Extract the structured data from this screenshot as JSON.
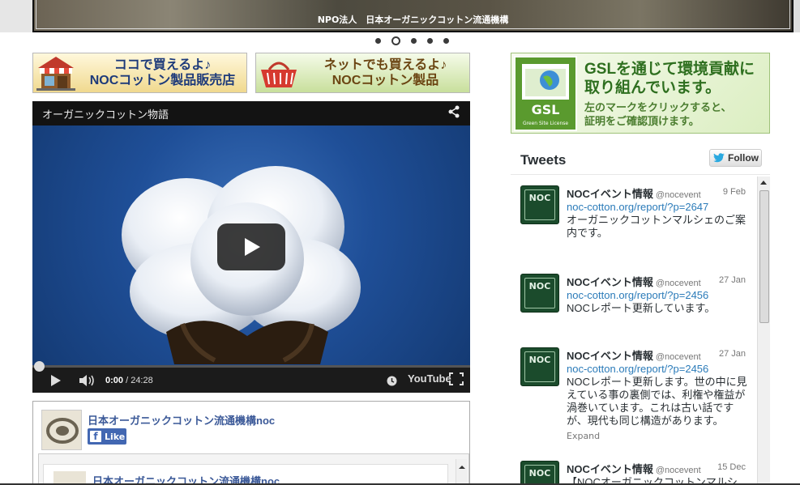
{
  "hero": {
    "caption": "NPO法人　日本オーガニックコットン流通機構",
    "dots": [
      false,
      true,
      false,
      false,
      false
    ]
  },
  "banners": {
    "shop": {
      "line1": "ココで買えるよ♪",
      "line2": "NOCコットン製品販売店"
    },
    "net": {
      "line1": "ネットでも買えるよ♪",
      "line2": "NOCコットン製品"
    }
  },
  "video": {
    "title": "オーガニックコットン物語",
    "current_time": "0:00",
    "duration": " / 24:28",
    "youtube_label": "YouTube"
  },
  "facebook": {
    "page_name": "日本オーガニックコットン流通機構noc",
    "like_label": "Like",
    "post_name": "日本オーガニックコットン流通機構noc"
  },
  "gsl": {
    "title_line1": "GSLを通じて環境貢献に",
    "title_line2": "取り組んでいます。",
    "sub_line1": "左のマークをクリックすると、",
    "sub_line2": "証明をご確認頂けます。",
    "logo_text": "GSL",
    "logo_sub": "Green Site License"
  },
  "tweets": {
    "heading": "Tweets",
    "follow_label": "Follow",
    "expand_label": "Expand",
    "items": [
      {
        "name": "NOCイベント情報",
        "handle": "@nocevent",
        "date": "9 Feb",
        "link": "noc-cotton.org/report/?p=2647",
        "text": "オーガニックコットンマルシェのご案内です。"
      },
      {
        "name": "NOCイベント情報",
        "handle": "@nocevent",
        "date": "27 Jan",
        "link": "noc-cotton.org/report/?p=2456",
        "text": "NOCレポート更新しています。"
      },
      {
        "name": "NOCイベント情報",
        "handle": "@nocevent",
        "date": "27 Jan",
        "link": "noc-cotton.org/report/?p=2456",
        "text": "NOCレポート更新します。世の中に見えている事の裏側では、利権や権益が渦巻いています。これは古い話ですが、現代も同じ構造があります。"
      },
      {
        "name": "NOCイベント情報",
        "handle": "@nocevent",
        "date": "15 Dec",
        "link": "",
        "text": "【NOCオーガニックコットンマルシェ】"
      }
    ]
  }
}
